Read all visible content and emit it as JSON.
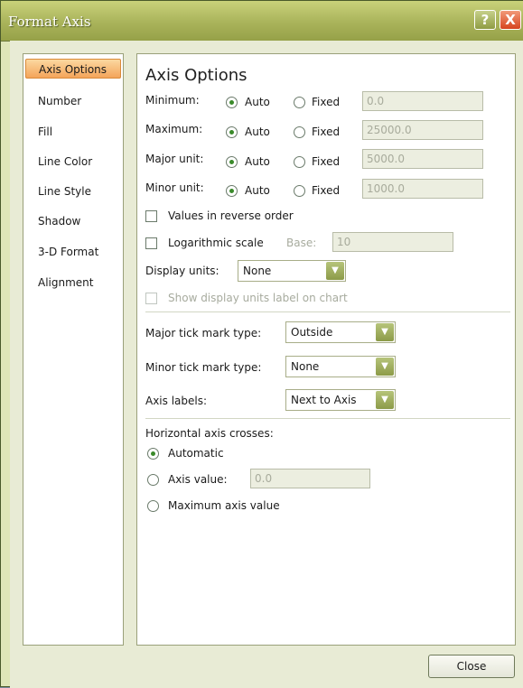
{
  "window": {
    "title": "Format Axis",
    "help": "?",
    "close": "X"
  },
  "nav": {
    "items": [
      "Axis Options",
      "Number",
      "Fill",
      "Line Color",
      "Line Style",
      "Shadow",
      "3-D Format",
      "Alignment"
    ],
    "selected": "Axis Options"
  },
  "panel": {
    "heading": "Axis Options",
    "rows": [
      {
        "label": "Minimum:",
        "auto": "Auto",
        "fixed": "Fixed",
        "value": "0.0",
        "selected": "auto"
      },
      {
        "label": "Maximum:",
        "auto": "Auto",
        "fixed": "Fixed",
        "value": "25000.0",
        "selected": "auto"
      },
      {
        "label": "Major unit:",
        "auto": "Auto",
        "fixed": "Fixed",
        "value": "5000.0",
        "selected": "auto"
      },
      {
        "label": "Minor unit:",
        "auto": "Auto",
        "fixed": "Fixed",
        "value": "1000.0",
        "selected": "auto"
      }
    ],
    "reverse_order": {
      "label": "Values in reverse order",
      "checked": false
    },
    "log_scale": {
      "label": "Logarithmic scale",
      "checked": false,
      "base_label": "Base:",
      "base_value": "10"
    },
    "display_units": {
      "label": "Display units:",
      "value": "None"
    },
    "show_units_label": {
      "label": "Show display units label on chart",
      "checked": false,
      "disabled": true
    },
    "major_tick": {
      "label": "Major tick mark type:",
      "value": "Outside"
    },
    "minor_tick": {
      "label": "Minor tick mark type:",
      "value": "None"
    },
    "axis_labels": {
      "label": "Axis labels:",
      "value": "Next to Axis"
    },
    "crosses": {
      "label": "Horizontal axis crosses:",
      "automatic": "Automatic",
      "axis_value": "Axis value:",
      "axis_value_input": "0.0",
      "maximum": "Maximum axis value",
      "selected": "automatic"
    }
  },
  "footer": {
    "close_label": "Close"
  },
  "colors": {
    "title_bar": "#a9b35a",
    "selection": "#f4a45a",
    "radio_dot": "#3a8a2a"
  }
}
